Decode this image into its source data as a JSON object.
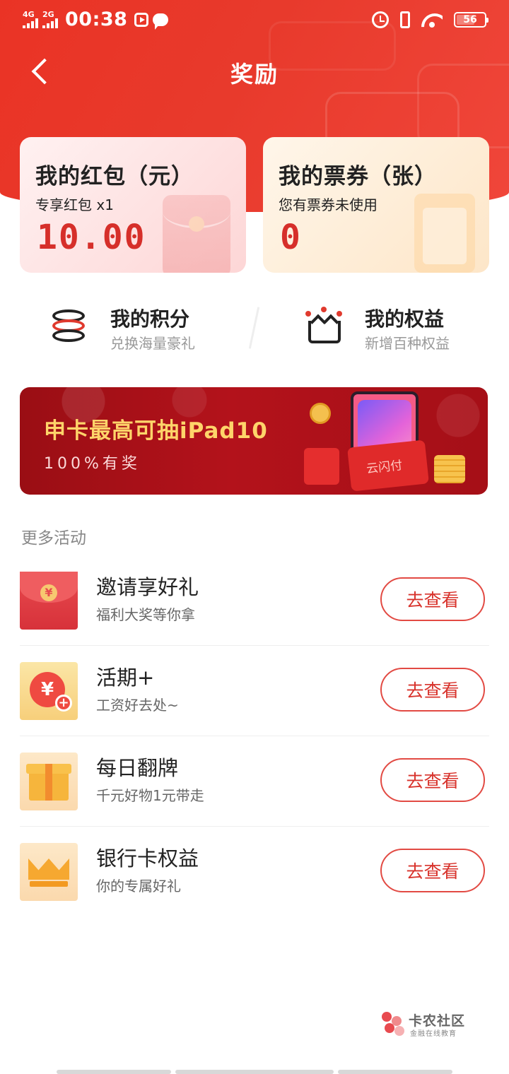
{
  "status_bar": {
    "network1": "4G",
    "network2": "2G",
    "time": "00:38",
    "battery": "56"
  },
  "header": {
    "title": "奖励"
  },
  "cards": [
    {
      "title": "我的红包（元）",
      "subtitle": "专享红包 x1",
      "value": "10.00"
    },
    {
      "title": "我的票券（张）",
      "subtitle": "您有票券未使用",
      "value": "0"
    }
  ],
  "quick_links": [
    {
      "title": "我的积分",
      "subtitle": "兑换海量豪礼"
    },
    {
      "title": "我的权益",
      "subtitle": "新增百种权益"
    }
  ],
  "banner": {
    "title": "申卡最高可抽iPad10",
    "subtitle": "100%有奖",
    "badge": "云闪付"
  },
  "more": {
    "section_title": "更多活动",
    "items": [
      {
        "title": "邀请享好礼",
        "subtitle": "福利大奖等你拿",
        "button": "去查看",
        "icon": "red-envelope-icon"
      },
      {
        "title": "活期+",
        "subtitle": "工资好去处~",
        "button": "去查看",
        "icon": "yuan-coin-plus-icon"
      },
      {
        "title": "每日翻牌",
        "subtitle": "千元好物1元带走",
        "button": "去查看",
        "icon": "gift-box-icon"
      },
      {
        "title": "银行卡权益",
        "subtitle": "你的专属好礼",
        "button": "去查看",
        "icon": "crown-icon"
      }
    ]
  },
  "watermark": {
    "title": "卡农社区",
    "subtitle": "金融在线教育"
  },
  "colors": {
    "brand_red": "#e83a2c",
    "accent_red": "#d62f2a",
    "banner_gold": "#ffd46a"
  }
}
